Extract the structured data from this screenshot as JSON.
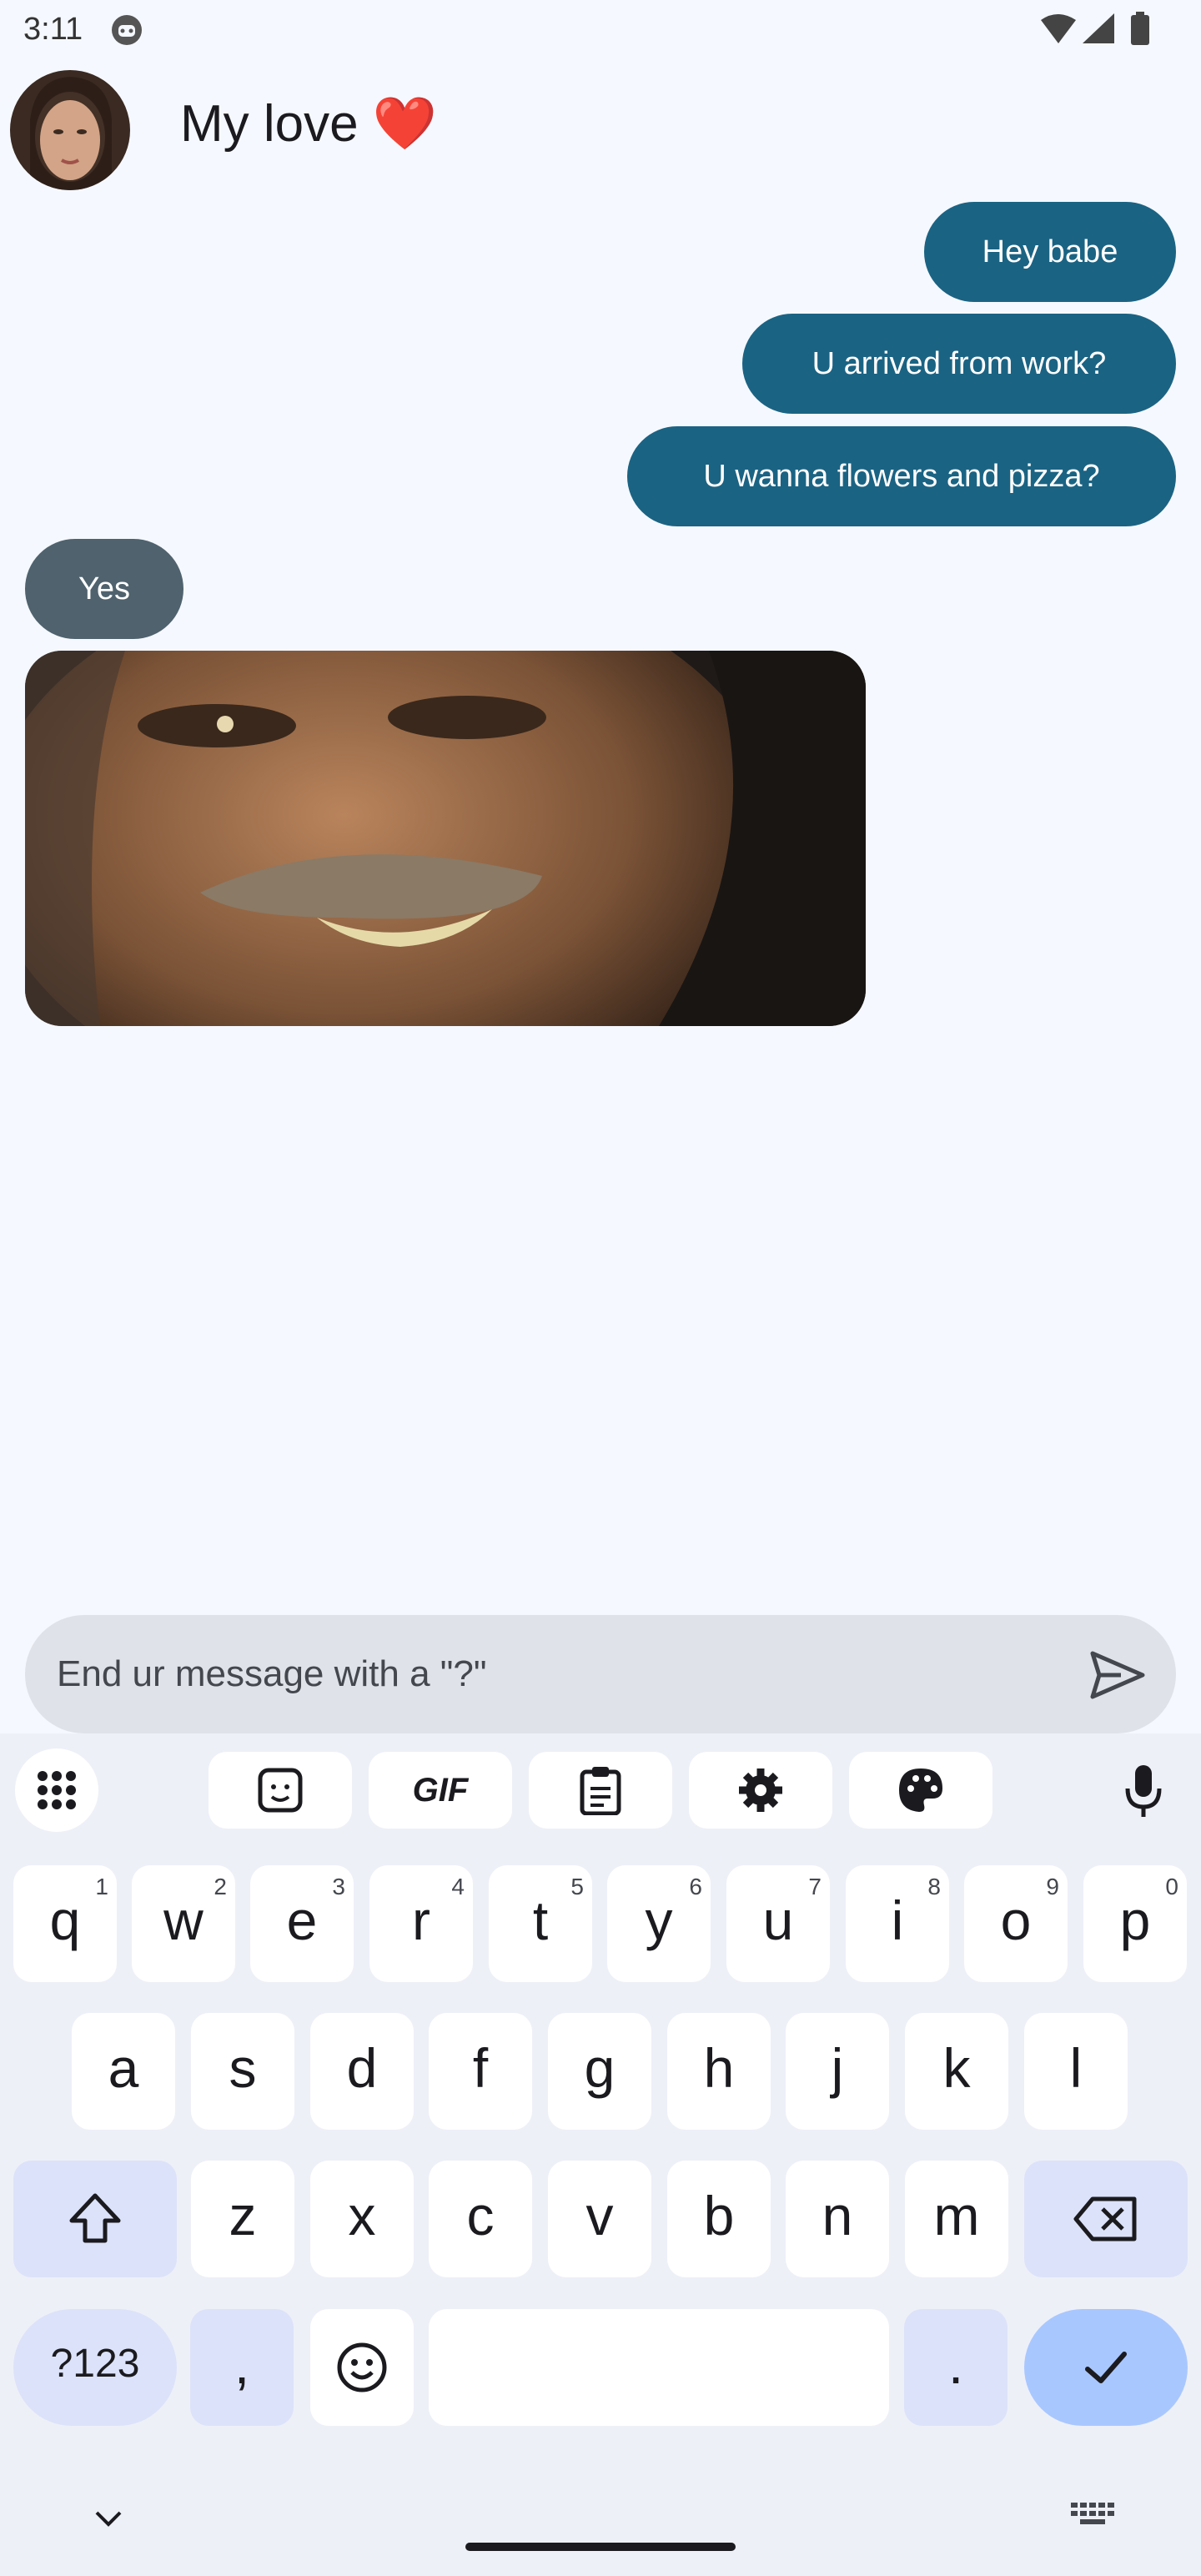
{
  "status_bar": {
    "time": "3:11"
  },
  "header": {
    "contact_name": "My love ❤️"
  },
  "messages": [
    {
      "direction": "outgoing",
      "text": "Hey babe"
    },
    {
      "direction": "outgoing",
      "text": "U arrived from work?"
    },
    {
      "direction": "outgoing",
      "text": "U wanna flowers and pizza?"
    },
    {
      "direction": "incoming",
      "text": "Yes"
    },
    {
      "direction": "incoming",
      "type": "gif-image"
    }
  ],
  "composer": {
    "placeholder": "End ur message with a \"?\""
  },
  "keyboard": {
    "row1": [
      {
        "key": "q",
        "hint": "1"
      },
      {
        "key": "w",
        "hint": "2"
      },
      {
        "key": "e",
        "hint": "3"
      },
      {
        "key": "r",
        "hint": "4"
      },
      {
        "key": "t",
        "hint": "5"
      },
      {
        "key": "y",
        "hint": "6"
      },
      {
        "key": "u",
        "hint": "7"
      },
      {
        "key": "i",
        "hint": "8"
      },
      {
        "key": "o",
        "hint": "9"
      },
      {
        "key": "p",
        "hint": "0"
      }
    ],
    "row2": [
      "a",
      "s",
      "d",
      "f",
      "g",
      "h",
      "j",
      "k",
      "l"
    ],
    "row3": [
      "z",
      "x",
      "c",
      "v",
      "b",
      "n",
      "m"
    ],
    "symbols_label": "?123",
    "comma_label": ",",
    "period_label": ".",
    "toolbar_gif_label": "GIF"
  },
  "colors": {
    "outgoing_bubble": "#1b6383",
    "incoming_bubble": "#4f626e",
    "background": "#f5f8fe",
    "enter_key": "#a9c7ff"
  },
  "icons": [
    "notification-robot-icon",
    "wifi-icon",
    "signal-icon",
    "battery-icon",
    "send-icon",
    "apps-grid-icon",
    "sticker-icon",
    "clipboard-icon",
    "settings-gear-icon",
    "palette-icon",
    "mic-icon",
    "shift-icon",
    "backspace-icon",
    "emoji-icon",
    "checkmark-icon",
    "chevron-down-icon",
    "keyboard-switch-icon"
  ]
}
